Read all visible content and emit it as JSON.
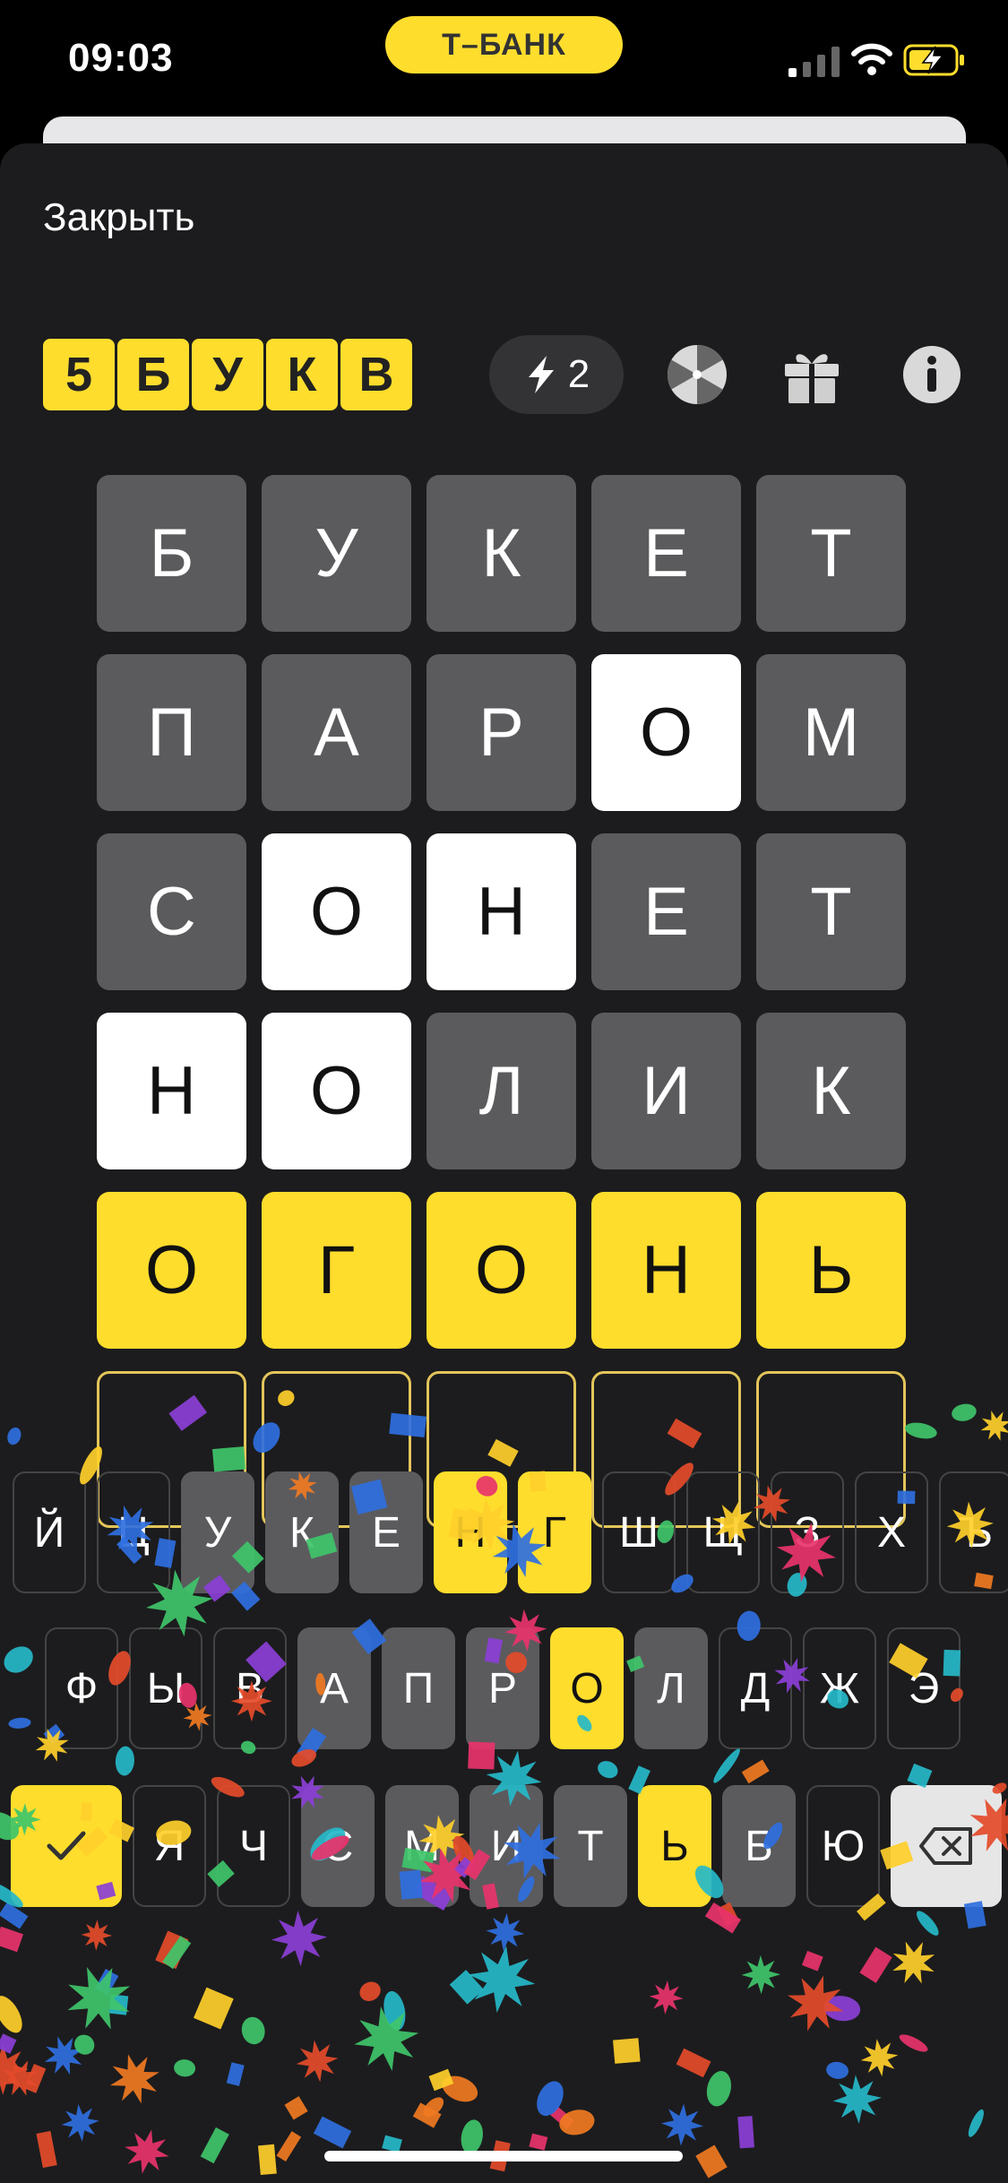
{
  "status_bar": {
    "time": "09:03",
    "bank_pill": "Т–БАНК"
  },
  "header": {
    "close_label": "Закрыть",
    "logo_letters": [
      "5",
      "Б",
      "У",
      "К",
      "В"
    ],
    "energy_count": "2"
  },
  "icons": {
    "energy": "lightning-icon",
    "wheel": "fortune-wheel-icon",
    "gift": "gift-icon",
    "info": "info-icon"
  },
  "board": [
    [
      {
        "l": "Б",
        "s": "gray"
      },
      {
        "l": "У",
        "s": "gray"
      },
      {
        "l": "К",
        "s": "gray"
      },
      {
        "l": "Е",
        "s": "gray"
      },
      {
        "l": "Т",
        "s": "gray"
      }
    ],
    [
      {
        "l": "П",
        "s": "gray"
      },
      {
        "l": "А",
        "s": "gray"
      },
      {
        "l": "Р",
        "s": "gray"
      },
      {
        "l": "О",
        "s": "white"
      },
      {
        "l": "М",
        "s": "gray"
      }
    ],
    [
      {
        "l": "С",
        "s": "gray"
      },
      {
        "l": "О",
        "s": "white"
      },
      {
        "l": "Н",
        "s": "white"
      },
      {
        "l": "Е",
        "s": "gray"
      },
      {
        "l": "Т",
        "s": "gray"
      }
    ],
    [
      {
        "l": "Н",
        "s": "white"
      },
      {
        "l": "О",
        "s": "white"
      },
      {
        "l": "Л",
        "s": "gray"
      },
      {
        "l": "И",
        "s": "gray"
      },
      {
        "l": "К",
        "s": "gray"
      }
    ],
    [
      {
        "l": "О",
        "s": "yellow"
      },
      {
        "l": "Г",
        "s": "yellow"
      },
      {
        "l": "О",
        "s": "yellow"
      },
      {
        "l": "Н",
        "s": "yellow"
      },
      {
        "l": "Ь",
        "s": "yellow"
      }
    ],
    [
      {
        "l": "",
        "s": "empty"
      },
      {
        "l": "",
        "s": "empty"
      },
      {
        "l": "",
        "s": "empty"
      },
      {
        "l": "",
        "s": "empty"
      },
      {
        "l": "",
        "s": "empty"
      }
    ]
  ],
  "keyboard": {
    "row1": [
      {
        "k": "Й",
        "s": "default"
      },
      {
        "k": "Ц",
        "s": "default"
      },
      {
        "k": "У",
        "s": "used"
      },
      {
        "k": "К",
        "s": "used"
      },
      {
        "k": "Е",
        "s": "used"
      },
      {
        "k": "Н",
        "s": "yellow"
      },
      {
        "k": "Г",
        "s": "yellow"
      },
      {
        "k": "Ш",
        "s": "default"
      },
      {
        "k": "Щ",
        "s": "default"
      },
      {
        "k": "З",
        "s": "default"
      },
      {
        "k": "Х",
        "s": "default"
      },
      {
        "k": "Ъ",
        "s": "default"
      }
    ],
    "row2": [
      {
        "k": "Ф",
        "s": "default"
      },
      {
        "k": "Ы",
        "s": "default"
      },
      {
        "k": "В",
        "s": "default"
      },
      {
        "k": "А",
        "s": "used"
      },
      {
        "k": "П",
        "s": "used"
      },
      {
        "k": "Р",
        "s": "used"
      },
      {
        "k": "О",
        "s": "yellow"
      },
      {
        "k": "Л",
        "s": "used"
      },
      {
        "k": "Д",
        "s": "default"
      },
      {
        "k": "Ж",
        "s": "default"
      },
      {
        "k": "Э",
        "s": "default"
      }
    ],
    "row3": [
      {
        "k": "Я",
        "s": "default"
      },
      {
        "k": "Ч",
        "s": "default"
      },
      {
        "k": "С",
        "s": "used"
      },
      {
        "k": "М",
        "s": "used"
      },
      {
        "k": "И",
        "s": "used"
      },
      {
        "k": "Т",
        "s": "used"
      },
      {
        "k": "Ь",
        "s": "yellow"
      },
      {
        "k": "Б",
        "s": "used"
      },
      {
        "k": "Ю",
        "s": "default"
      }
    ],
    "enter_icon": "checkmark-icon",
    "backspace_icon": "backspace-icon"
  },
  "colors": {
    "yellow": "#ffdd2d",
    "gray": "#5b5b5e",
    "sheet": "#1c1c1e"
  }
}
